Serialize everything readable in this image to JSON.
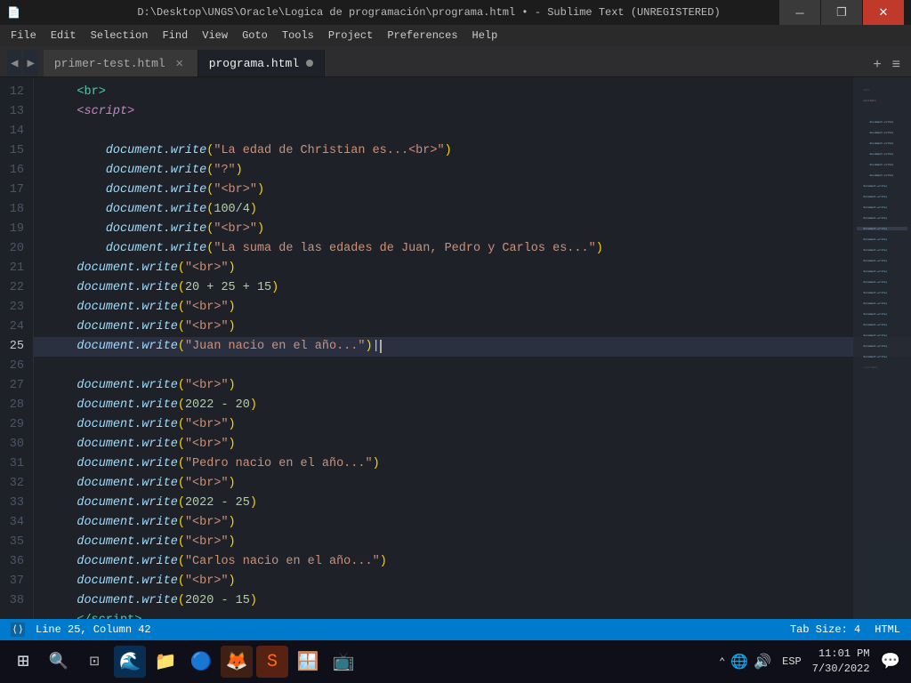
{
  "titlebar": {
    "text": "D:\\Desktop\\UNGS\\Oracle\\Logica de programación\\programa.html • - Sublime Text (UNREGISTERED)",
    "controls": [
      "─",
      "❐",
      "✕"
    ]
  },
  "menubar": {
    "items": [
      "File",
      "Edit",
      "Selection",
      "Find",
      "View",
      "Goto",
      "Tools",
      "Project",
      "Preferences",
      "Help"
    ]
  },
  "tabs": [
    {
      "label": "primer-test.html",
      "active": false,
      "modified": false
    },
    {
      "label": "programa.html",
      "active": true,
      "modified": true
    }
  ],
  "statusbar": {
    "left": "Line 25, Column 42",
    "tab_size": "Tab Size: 4",
    "language": "HTML"
  },
  "taskbar": {
    "time": "11:01 PM",
    "date": "7/30/2022",
    "language": "ESP"
  }
}
